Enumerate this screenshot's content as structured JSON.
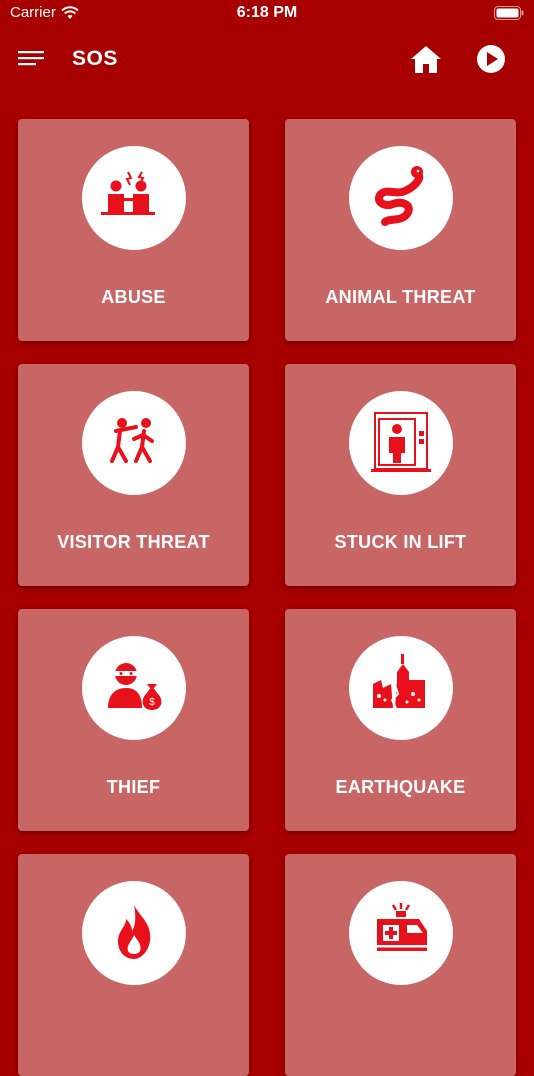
{
  "status_bar": {
    "carrier": "Carrier",
    "time": "6:18 PM"
  },
  "app_bar": {
    "title": "SOS"
  },
  "tiles": [
    {
      "label": "ABUSE",
      "icon": "abuse-icon"
    },
    {
      "label": "ANIMAL THREAT",
      "icon": "snake-icon"
    },
    {
      "label": "VISITOR THREAT",
      "icon": "visitor-threat-icon"
    },
    {
      "label": "STUCK IN LIFT",
      "icon": "elevator-person-icon"
    },
    {
      "label": "THIEF",
      "icon": "thief-icon"
    },
    {
      "label": "EARTHQUAKE",
      "icon": "earthquake-building-icon"
    },
    {
      "label": "",
      "icon": "fire-icon"
    },
    {
      "label": "",
      "icon": "ambulance-icon"
    }
  ],
  "colors": {
    "background": "#a80000",
    "tile": "#c86666",
    "icon": "#e8101a",
    "text": "#ffffff"
  }
}
